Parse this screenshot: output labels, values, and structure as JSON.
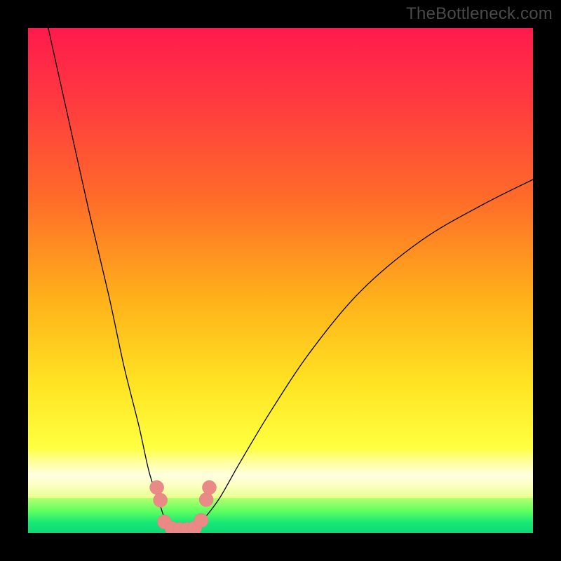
{
  "watermark": "TheBottleneck.com",
  "colors": {
    "frame": "#000000",
    "curve_stroke": "#000000",
    "marker_fill": "#e98a87",
    "marker_stroke": "#d97f7c"
  },
  "chart_data": {
    "type": "line",
    "title": "",
    "xlabel": "",
    "ylabel": "",
    "xlim": [
      0,
      100
    ],
    "ylim": [
      0,
      100
    ],
    "grid": false,
    "legend": false,
    "note": "Values are read off the rendered pixels as percentages of the plot area (0 = bottom / left, 100 = top / right). No numeric axes are shown.",
    "series": [
      {
        "name": "left-branch",
        "x": [
          4,
          8,
          12,
          16,
          19,
          22,
          24,
          26,
          27,
          28,
          29,
          31
        ],
        "y": [
          100,
          82,
          64,
          47,
          33,
          21,
          12,
          6,
          3,
          1.5,
          0.8,
          0.5
        ]
      },
      {
        "name": "right-branch",
        "x": [
          31,
          33,
          35,
          38,
          42,
          48,
          56,
          66,
          78,
          90,
          100
        ],
        "y": [
          0.5,
          1,
          3,
          7,
          14,
          24,
          36,
          48,
          58,
          65,
          70
        ]
      }
    ],
    "markers": {
      "name": "salmon-dots-near-minimum",
      "points": [
        {
          "x": 25.5,
          "y": 9
        },
        {
          "x": 26.2,
          "y": 6.5
        },
        {
          "x": 27.0,
          "y": 2.2
        },
        {
          "x": 28.5,
          "y": 0.9
        },
        {
          "x": 30.0,
          "y": 0.7
        },
        {
          "x": 31.5,
          "y": 0.7
        },
        {
          "x": 33.0,
          "y": 1.0
        },
        {
          "x": 34.3,
          "y": 2.5
        },
        {
          "x": 35.3,
          "y": 6.6
        },
        {
          "x": 35.9,
          "y": 9.0
        }
      ],
      "radius_pct": 1.4
    }
  }
}
